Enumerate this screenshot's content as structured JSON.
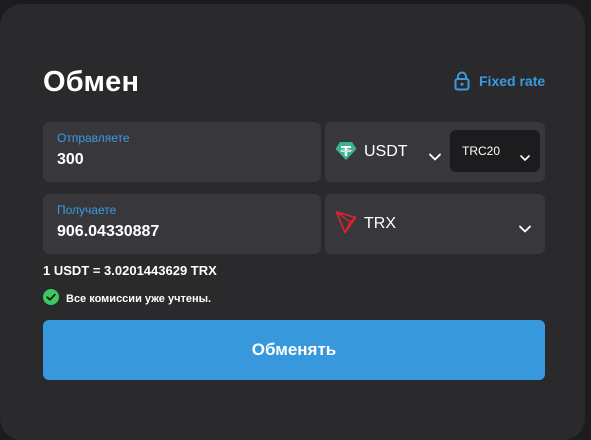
{
  "exchange": {
    "title": "Обмен",
    "fixed_rate_label": "Fixed rate",
    "send": {
      "label": "Отправляете",
      "amount": "300",
      "currency": "USDT",
      "network": "TRC20"
    },
    "receive": {
      "label": "Получаете",
      "amount": "906.04330887",
      "currency": "TRX"
    },
    "rate_text": "1 USDT = 3.0201443629 TRX",
    "fees_note": "Все комиссии уже учтены.",
    "submit_label": "Обменять"
  },
  "colors": {
    "accent": "#3a9be0",
    "button": "#3798dc",
    "success": "#3dc95f",
    "usdt": "#3cb38e",
    "trx": "#e0232b"
  },
  "icons": [
    "lock-icon",
    "usdt-icon",
    "trx-icon",
    "chevron-down-icon",
    "check-circle-icon"
  ]
}
